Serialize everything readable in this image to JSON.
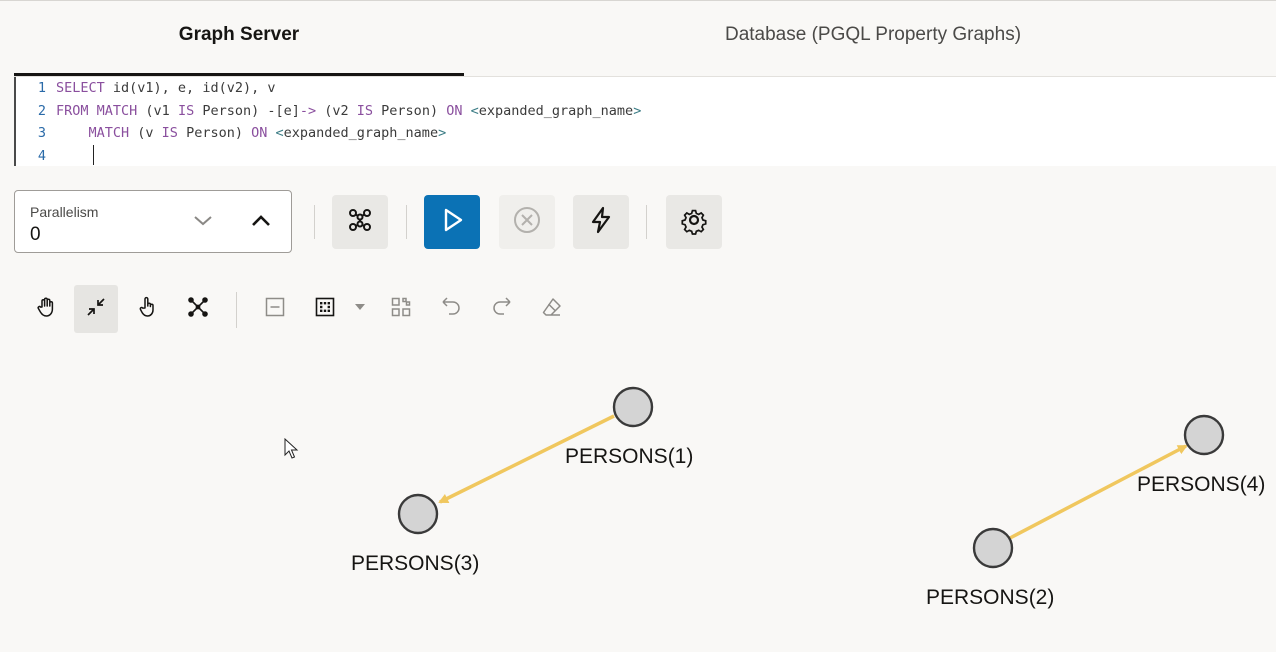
{
  "tabs": {
    "graph_server": "Graph Server",
    "database": "Database (PGQL Property Graphs)"
  },
  "editor": {
    "lines": [
      {
        "num": "1",
        "tokens": [
          [
            "kw",
            "SELECT"
          ],
          [
            "id",
            " id(v1), e, id(v2), v"
          ]
        ]
      },
      {
        "num": "2",
        "tokens": [
          [
            "kw",
            "FROM"
          ],
          [
            "id",
            " "
          ],
          [
            "kw",
            "MATCH"
          ],
          [
            "id",
            " (v1 "
          ],
          [
            "kw",
            "IS"
          ],
          [
            "id",
            " Person) -[e]"
          ],
          [
            "kw",
            "->"
          ],
          [
            "id",
            " (v2 "
          ],
          [
            "kw",
            "IS"
          ],
          [
            "id",
            " Person) "
          ],
          [
            "kw",
            "ON"
          ],
          [
            "id",
            " "
          ],
          [
            "ang",
            "<"
          ],
          [
            "id",
            "expanded_graph_name"
          ],
          [
            "ang",
            ">"
          ]
        ]
      },
      {
        "num": "3",
        "tokens": [
          [
            "id",
            "    "
          ],
          [
            "kw",
            "MATCH"
          ],
          [
            "id",
            " (v "
          ],
          [
            "kw",
            "IS"
          ],
          [
            "id",
            " Person) "
          ],
          [
            "kw",
            "ON"
          ],
          [
            "id",
            " "
          ],
          [
            "ang",
            "<"
          ],
          [
            "id",
            "expanded_graph_name"
          ],
          [
            "ang",
            ">"
          ]
        ]
      },
      {
        "num": "4",
        "tokens": []
      }
    ]
  },
  "parallelism": {
    "label": "Parallelism",
    "value": "0"
  },
  "toolbar": {
    "graph_icon": "graph-visualization-icon",
    "run_icon": "play-icon",
    "cancel_icon": "cancel-circle-icon",
    "lightning_icon": "lightning-icon",
    "settings_icon": "gear-icon"
  },
  "colors": {
    "primary": "#0b72b5",
    "edge": "#f0c75e",
    "node_fill": "#d4d4d4",
    "node_stroke": "#3a3a3a"
  },
  "graph": {
    "nodes": [
      {
        "id": "p1",
        "label": "PERSONS(1)"
      },
      {
        "id": "p3",
        "label": "PERSONS(3)"
      },
      {
        "id": "p2",
        "label": "PERSONS(2)"
      },
      {
        "id": "p4",
        "label": "PERSONS(4)"
      }
    ],
    "edges": [
      {
        "from": "p1",
        "to": "p3"
      },
      {
        "from": "p2",
        "to": "p4"
      }
    ]
  }
}
